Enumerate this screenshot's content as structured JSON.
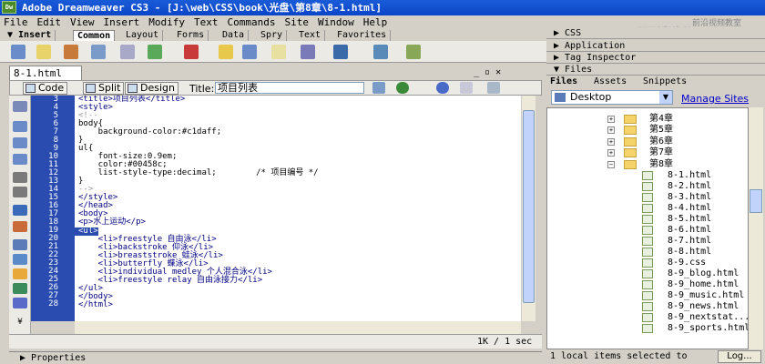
{
  "window_title": "Adobe Dreamweaver CS3 - [J:\\web\\CSS\\book\\光盘\\第8章\\8-1.html]",
  "app_logo_text": "Dw",
  "watermark": {
    "cn": "前沿视频教室",
    "url": "www.artech.cn"
  },
  "menu": [
    "File",
    "Edit",
    "View",
    "Insert",
    "Modify",
    "Text",
    "Commands",
    "Site",
    "Window",
    "Help"
  ],
  "insert_bar": {
    "label": "▼ Insert",
    "tabs": [
      "Common",
      "Layout",
      "Forms",
      "Data",
      "Spry",
      "Text",
      "Favorites"
    ],
    "active": "Common"
  },
  "icons_insert": [
    "hyperlink-icon",
    "email-icon",
    "anchor-icon",
    "table-icon",
    "layer-icon",
    "image-icon",
    "media-icon",
    "date-icon",
    "server-icon",
    "comment-icon",
    "head-icon",
    "script-icon",
    "template-icon",
    "tag-chooser-icon"
  ],
  "document": {
    "tab": "8-1.html",
    "window_controls": "_ ▫ ✕",
    "buttons": {
      "code": "Code",
      "split": "Split",
      "design": "Design"
    },
    "title_label": "Title:",
    "title_value": "项目列表",
    "line_numbers": [
      "3",
      "4",
      "5",
      "6",
      "7",
      "8",
      "9",
      "10",
      "11",
      "12",
      "13",
      "14",
      "15",
      "16",
      "17",
      "18",
      "19",
      "20",
      "21",
      "22",
      "23",
      "24",
      "25",
      "26",
      "27",
      "28"
    ],
    "code_lines": [
      "<title>项目列表</title>",
      "<style>",
      "<!--",
      "body{",
      "    background-color:#c1daff;",
      "}",
      "ul{",
      "    font-size:0.9em;",
      "    color:#00458c;",
      "    list-style-type:decimal;        /* 项目编号 */",
      "}",
      "-->",
      "</style>",
      "</head>",
      "<body>",
      "<p>水上运动</p>",
      "<ul>",
      "    <li>freestyle 自由泳</li>",
      "    <li>backstroke 仰泳</li>",
      "    <li>breaststroke 蛙泳</li>",
      "    <li>butterfly 蝶泳</li>",
      "    <li>individual medley 个人混合泳</li>",
      "    <li>freestyle relay 自由泳接力</li>",
      "</ul>",
      "</body>",
      "</html>"
    ],
    "status": "1K / 1 sec"
  },
  "properties_label": "▶ Properties",
  "panels": {
    "groups": [
      "▶ CSS",
      "▶ Application",
      "▶ Tag Inspector",
      "▼ Files"
    ],
    "file_tabs": [
      "Files",
      "Assets",
      "Snippets"
    ],
    "site": "Desktop",
    "manage_sites": "Manage Sites",
    "folders": [
      "第4章",
      "第5章",
      "第6章",
      "第7章",
      "第8章"
    ],
    "files": [
      "8-1.html",
      "8-2.html",
      "8-3.html",
      "8-4.html",
      "8-5.html",
      "8-6.html",
      "8-7.html",
      "8-8.html",
      "8-9.css",
      "8-9_blog.html",
      "8-9_home.html",
      "8-9_music.html",
      "8-9_news.html",
      "8-9_nextstat...",
      "8-9_sports.html"
    ],
    "status": "1 local items selected to",
    "log_button": "Log..."
  }
}
